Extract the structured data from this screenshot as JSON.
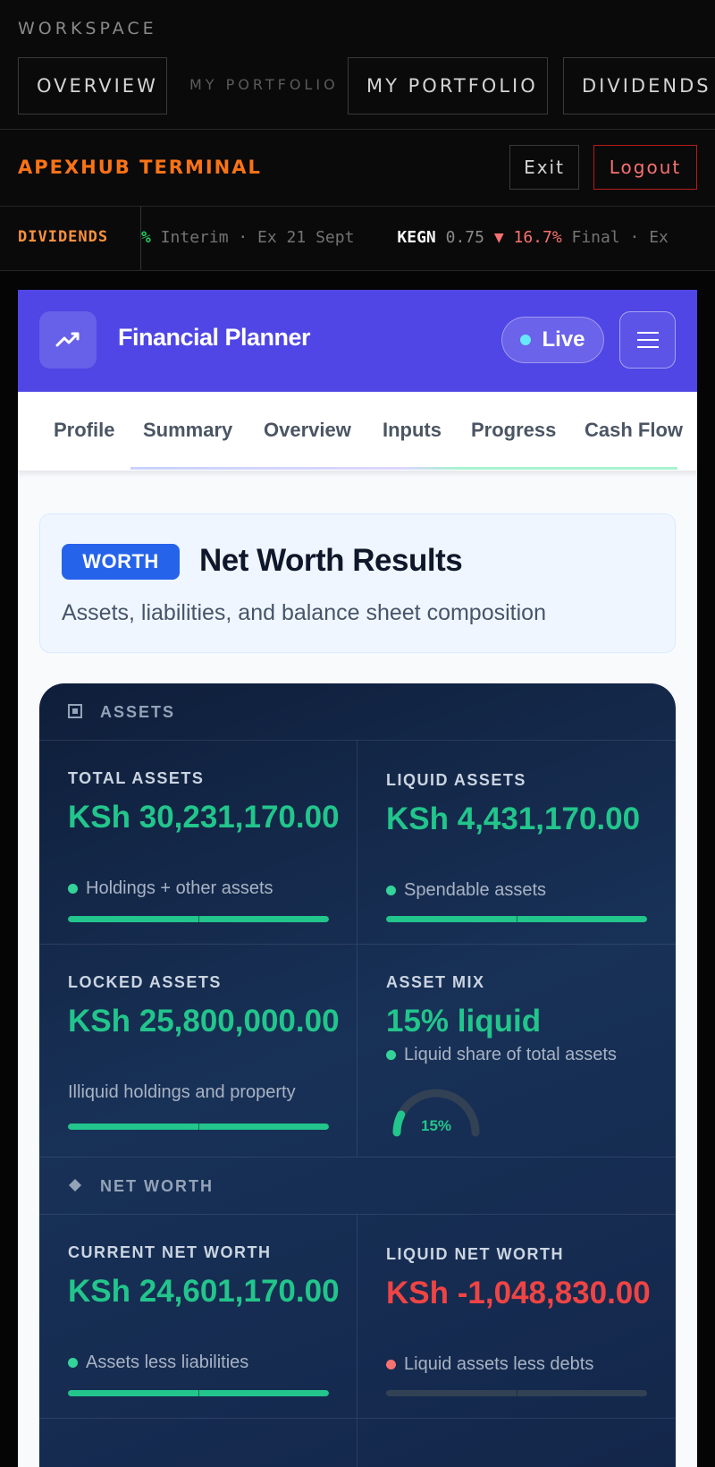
{
  "workspace": {
    "label": "WORKSPACE",
    "tabs": [
      {
        "label": "OVERVIEW"
      },
      {
        "label": "MY PORTFOLIO"
      },
      {
        "label": "DIVIDENDS"
      }
    ],
    "ghost_label": "MY PORTFOLIO"
  },
  "brandbar": {
    "brand": "APEXHUB TERMINAL",
    "exit_label": "Exit",
    "logout_label": "Logout"
  },
  "ticker": {
    "label": "DIVIDENDS",
    "seg1_pct": "%",
    "seg1_text": " Interim · Ex 21 Sept",
    "seg2_symbol": "KEGN",
    "seg2_price": " 0.75 ",
    "seg2_change": "▼ 16.7%",
    "seg2_text": " Final · Ex"
  },
  "app": {
    "title": "Financial Planner",
    "live_label": "Live",
    "logo_icon": "trend-up-icon",
    "menu_icon": "hamburger-icon",
    "tabs": [
      {
        "label": "Profile"
      },
      {
        "label": "Summary"
      },
      {
        "label": "Overview"
      },
      {
        "label": "Inputs"
      },
      {
        "label": "Progress"
      },
      {
        "label": "Cash Flow"
      }
    ]
  },
  "section": {
    "badge": "WORTH",
    "title": "Net Worth Results",
    "subtitle": "Assets, liabilities, and balance sheet composition"
  },
  "assets": {
    "group_label": "ASSETS",
    "total": {
      "label": "TOTAL ASSETS",
      "value": "KSh 30,231,170.00",
      "note": "Holdings + other assets",
      "fill": 1.0
    },
    "liquid": {
      "label": "LIQUID ASSETS",
      "value": "KSh 4,431,170.00",
      "note": "Spendable assets",
      "fill": 1.0
    },
    "locked": {
      "label": "LOCKED ASSETS",
      "value": "KSh 25,800,000.00",
      "note": "Illiquid holdings and property",
      "fill": 1.0
    },
    "mix": {
      "label": "ASSET MIX",
      "value": "15% liquid",
      "note": "Liquid share of total assets",
      "gauge_label": "15%",
      "gauge_fraction": 0.15
    }
  },
  "networth": {
    "group_label": "NET WORTH",
    "current": {
      "label": "CURRENT NET WORTH",
      "value": "KSh 24,601,170.00",
      "note": "Assets less liabilities",
      "fill": 1.0
    },
    "liquid": {
      "label": "LIQUID NET WORTH",
      "value": "KSh -1,048,830.00",
      "note": "Liquid assets less debts",
      "fill": 0.0
    }
  },
  "colors": {
    "accent": "#4f46e5",
    "positive": "#22c58b",
    "negative": "#ef4444",
    "brand": "#f97316"
  }
}
